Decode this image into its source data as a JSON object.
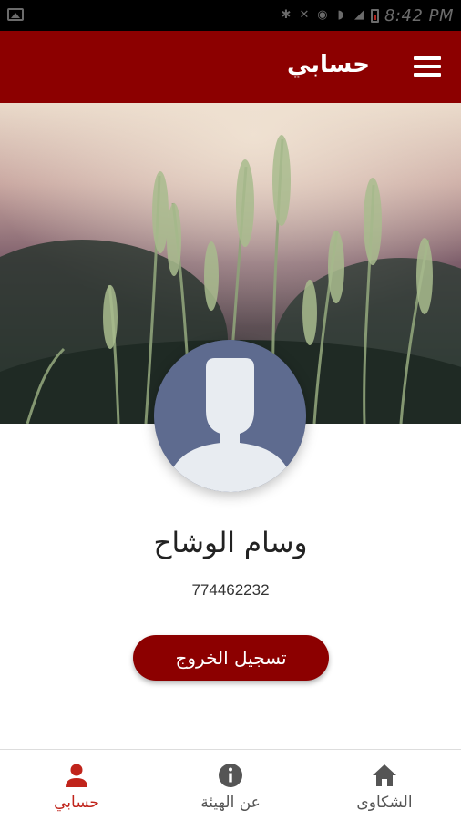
{
  "status_bar": {
    "time": "8:42 PM"
  },
  "app_bar": {
    "title": "حسابي",
    "menu_icon": "hamburger-menu-icon"
  },
  "profile": {
    "name": "وسام الوشاح",
    "phone": "774462232",
    "logout_label": "تسجيل الخروج"
  },
  "bottom_nav": {
    "items": [
      {
        "label": "حسابي",
        "icon": "person-icon",
        "active": true
      },
      {
        "label": "عن الهيئة",
        "icon": "info-icon",
        "active": false
      },
      {
        "label": "الشكاوى",
        "icon": "home-icon",
        "active": false
      }
    ]
  },
  "colors": {
    "primary": "#8c0000",
    "active_nav": "#c0241b",
    "avatar_bg": "#5e6b8f",
    "inactive_nav": "#555555"
  }
}
